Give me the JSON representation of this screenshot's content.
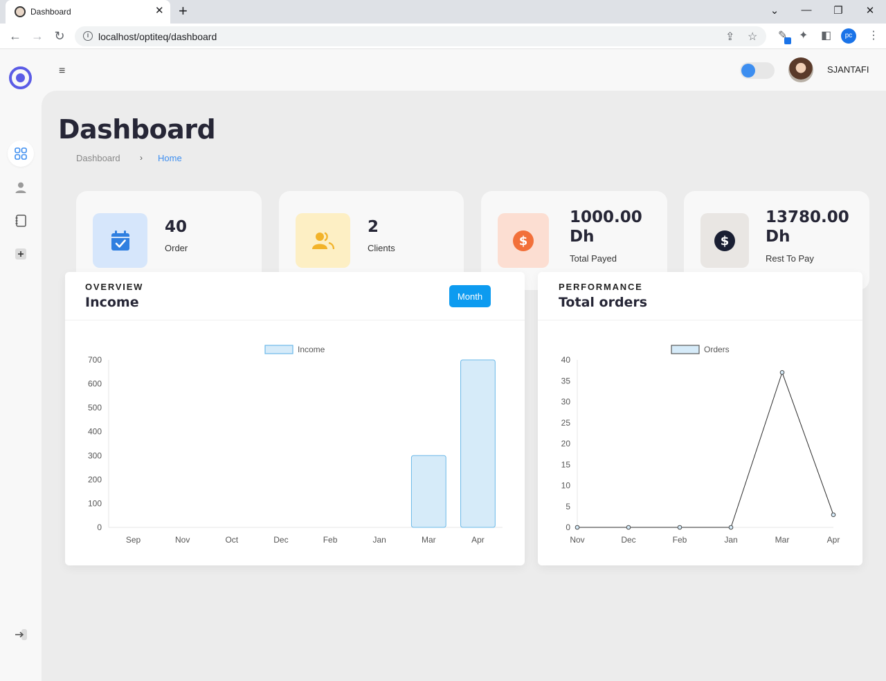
{
  "browser": {
    "tab_title": "Dashboard",
    "url": "localhost/optiteq/dashboard",
    "profile_initials": "pc"
  },
  "header": {
    "username": "SJANTAFI",
    "dark_mode_toggle": "off"
  },
  "page": {
    "title": "Dashboard",
    "breadcrumb": [
      "Dashboard",
      "Home"
    ]
  },
  "sidebar": {
    "items": [
      {
        "icon": "grid-icon",
        "active": true
      },
      {
        "icon": "user-icon",
        "active": false
      },
      {
        "icon": "book-icon",
        "active": false
      },
      {
        "icon": "plus-icon",
        "active": false
      }
    ],
    "logout_icon": "logout-icon"
  },
  "stats": [
    {
      "value": "40",
      "label": "Order",
      "icon": "calendar-check-icon",
      "bg": "#d6e6fb",
      "fg": "#2f7fe0"
    },
    {
      "value": "2",
      "label": "Clients",
      "icon": "users-icon",
      "bg": "#fdefc4",
      "fg": "#f2b32a"
    },
    {
      "value": "1000.00 Dh",
      "label": "Total Payed",
      "icon": "dollar-icon",
      "bg": "#fcded2",
      "fg": "#f2703a"
    },
    {
      "value": "13780.00 Dh",
      "label": "Rest To Pay",
      "icon": "dollar-icon",
      "bg": "#e9e6e3",
      "fg": "#1a1f33"
    }
  ],
  "income_panel": {
    "kicker": "OVERVIEW",
    "title": "Income",
    "button": "Month"
  },
  "orders_panel": {
    "kicker": "PERFORMANCE",
    "title": "Total orders"
  },
  "chart_data": [
    {
      "type": "bar",
      "categories": [
        "Sep",
        "Nov",
        "Oct",
        "Dec",
        "Feb",
        "Jan",
        "Mar",
        "Apr"
      ],
      "series": [
        {
          "name": "Income",
          "values": [
            0,
            0,
            0,
            0,
            0,
            0,
            300,
            700
          ]
        }
      ],
      "ylim": [
        0,
        700
      ],
      "yticks": [
        0,
        100,
        200,
        300,
        400,
        500,
        600,
        700
      ],
      "legend": "top-center",
      "grid": false,
      "color": "#d6ebf9",
      "stroke": "#6ab8e8"
    },
    {
      "type": "line",
      "categories": [
        "Nov",
        "Dec",
        "Feb",
        "Jan",
        "Mar",
        "Apr"
      ],
      "series": [
        {
          "name": "Orders",
          "values": [
            0,
            0,
            0,
            0,
            37,
            3
          ]
        }
      ],
      "ylim": [
        0,
        40
      ],
      "yticks": [
        0,
        5,
        10,
        15,
        20,
        25,
        30,
        35,
        40
      ],
      "legend": "top-center",
      "grid": false,
      "color": "#d6ebf9",
      "stroke": "#2b2b2b"
    }
  ]
}
